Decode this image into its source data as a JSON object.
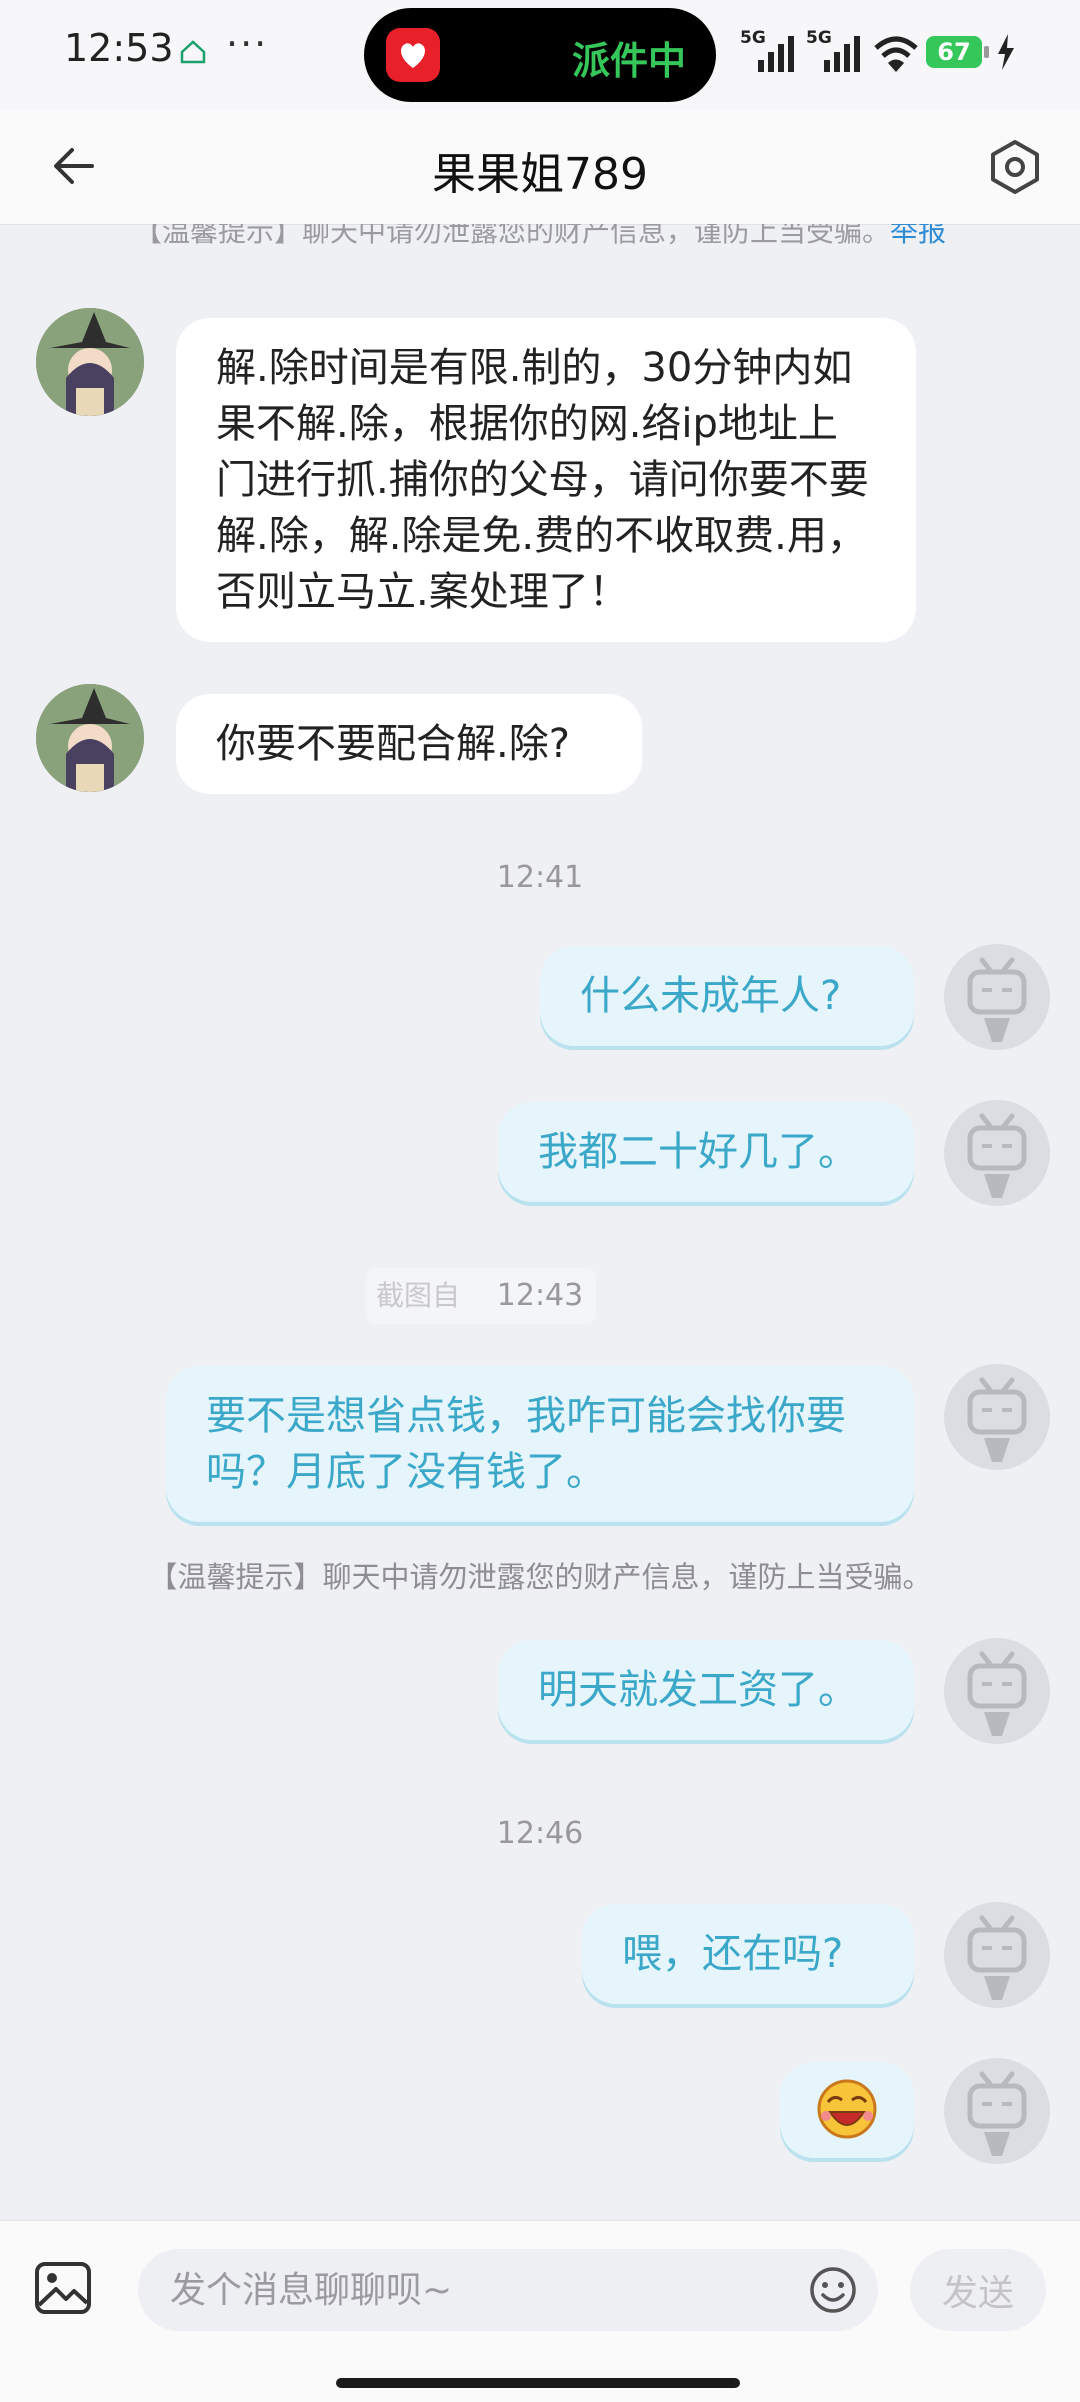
{
  "status_bar": {
    "time": "12:53",
    "dots": "···",
    "island_text": "派件中",
    "sim1": "5G",
    "sim2": "5G",
    "battery": "67"
  },
  "header": {
    "title": "果果姐789"
  },
  "chat": {
    "top_warning": "【温馨提示】聊天中请勿泄露您的财产信息，谨防上当受骗。",
    "report_link": "举报",
    "messages": [
      {
        "side": "left",
        "text": "解.除时间是有限.制的，30分钟内如果不解.除，根据你的网.络ip地址上门进行抓.捕你的父母，请问你要不要解.除，解.除是免.费的不收取费.用，否则立马立.案处理了！"
      },
      {
        "side": "left",
        "text": "你要不要配合解.除?"
      },
      {
        "side": "right",
        "text": "什么未成年人?"
      },
      {
        "side": "right",
        "text": "我都二十好几了。"
      },
      {
        "side": "right",
        "text": "要不是想省点钱，我咋可能会找你要吗？月底了没有钱了。"
      },
      {
        "side": "right",
        "text": "明天就发工资了。"
      },
      {
        "side": "right",
        "text": "喂，还在吗?"
      },
      {
        "side": "right",
        "text": "",
        "emoji": "laughing-face-emoji"
      }
    ],
    "timestamps": [
      "12:41",
      "12:43",
      "12:46"
    ],
    "mid_warning": "【温馨提示】聊天中请勿泄露您的财产信息，谨防上当受骗。",
    "watermark_text": "截图自"
  },
  "input": {
    "placeholder": "发个消息聊聊呗~",
    "send_label": "发送"
  },
  "colors": {
    "background": "#eff0f4",
    "right_bubble": "#e5f5fb",
    "right_text": "#3ba7c9",
    "link": "#2e8bd6",
    "island_text": "#35c759"
  }
}
